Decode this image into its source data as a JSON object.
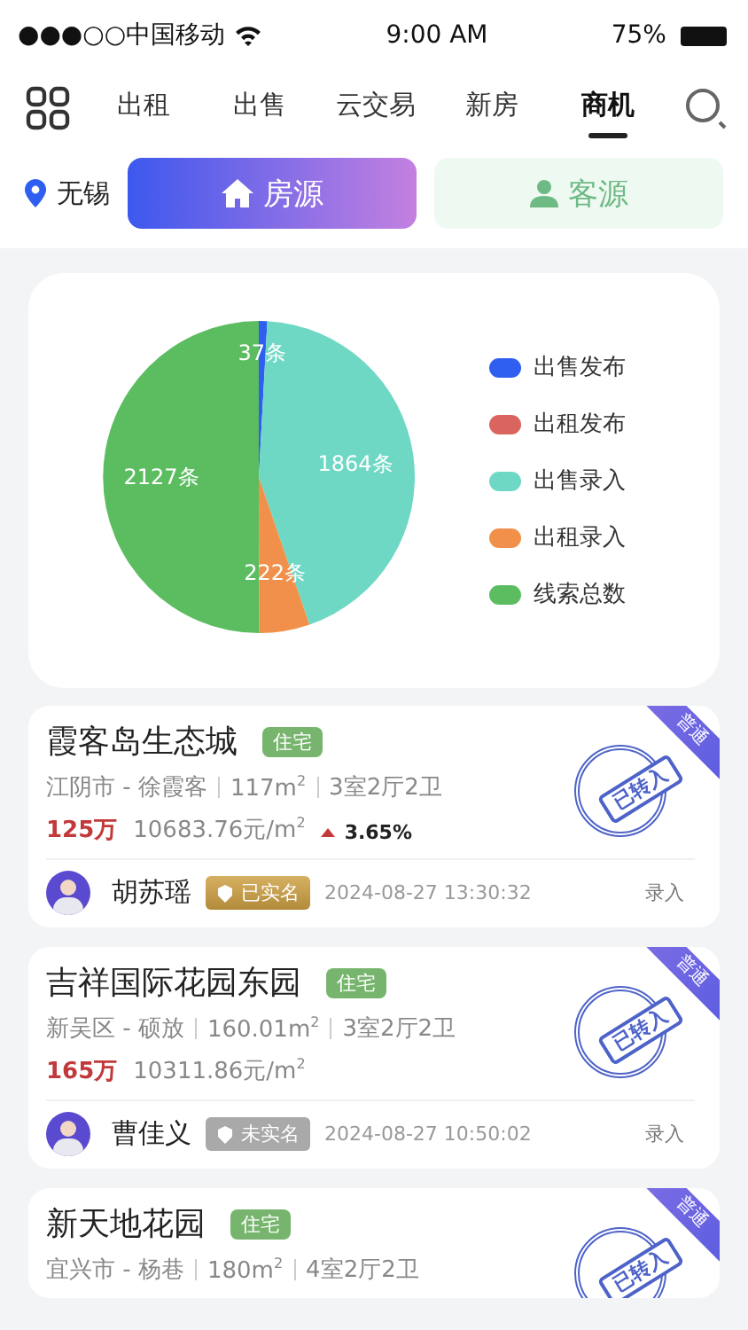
{
  "status_bar": {
    "carrier": "●●●○○中国移动",
    "time": "9:00 AM",
    "battery": "75%"
  },
  "tabs": [
    {
      "label": "出租",
      "selected": false
    },
    {
      "label": "出售",
      "selected": false
    },
    {
      "label": "云交易",
      "selected": false
    },
    {
      "label": "新房",
      "selected": false
    },
    {
      "label": "商机",
      "selected": true
    }
  ],
  "city": "无锡",
  "segments": [
    {
      "label": "房源",
      "selected": true,
      "kind": "house"
    },
    {
      "label": "客源",
      "selected": false,
      "kind": "person"
    }
  ],
  "chart": {
    "chart_data": {
      "type": "pie",
      "categories": [
        "出售发布",
        "出租发布",
        "出售录入",
        "出租录入",
        "线索总数"
      ],
      "values": [
        37,
        0,
        1864,
        222,
        2127
      ],
      "colors": [
        "#2f5ff0",
        "#d9655e",
        "#6ed8c4",
        "#f0904a",
        "#5cbd60"
      ],
      "value_labels": [
        "37条",
        null,
        "1864条",
        "222条",
        "2127条"
      ]
    }
  },
  "listings": [
    {
      "title": "霞客岛生态城",
      "tag": "住宅",
      "location": "江阴市 - 徐霞客",
      "size": "117m$^{2}$",
      "layout": "3室2厅2卫",
      "price": "125万",
      "unit_price": "10683.76元/m$^{2}$",
      "change": "3.65%",
      "badge": "普通",
      "stamp": "已转入",
      "agent": "胡苏瑶",
      "verified": true,
      "verify_label": "已实名",
      "time": "2024-08-27 13:30:32",
      "action": "录入"
    },
    {
      "title": "吉祥国际花园东园",
      "tag": "住宅",
      "location": "新吴区 - 硕放",
      "size": "160.01m$^{2}$",
      "layout": "3室2厅2卫",
      "price": "165万",
      "unit_price": "10311.86元/m$^{2}$",
      "badge": "普通",
      "stamp": "已转入",
      "agent": "曹佳义",
      "verified": false,
      "verify_label": "未实名",
      "time": "2024-08-27 10:50:02",
      "action": "录入"
    },
    {
      "title": "新天地花园",
      "tag": "住宅",
      "location": "宜兴市 - 杨巷",
      "size": "180m$^{2}$",
      "layout": "4室2厅2卫",
      "badge": "普通",
      "stamp": "已转入"
    }
  ]
}
